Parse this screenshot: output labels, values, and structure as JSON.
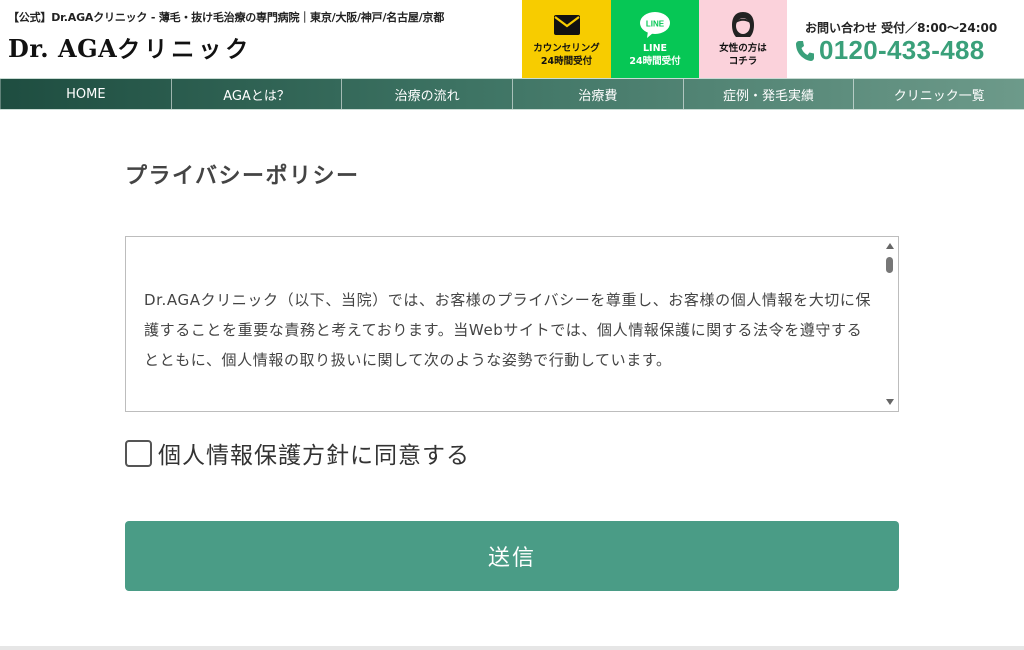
{
  "header": {
    "tagline": "【公式】Dr.AGAクリニック - 薄毛・抜け毛治療の専門病院｜東京/大阪/神戸/名古屋/京都",
    "logo_latin": "Dr. AGA",
    "logo_kana": "クリニック",
    "buttons": [
      {
        "line1": "カウンセリング",
        "line2": "24時間受付",
        "icon": "mail-icon",
        "color": "#f7cc00"
      },
      {
        "line1": "LINE",
        "line2": "24時間受付",
        "icon": "line-chat-icon",
        "color": "#06c755"
      },
      {
        "line1": "女性の方は",
        "line2": "コチラ",
        "icon": "woman-icon",
        "color": "#fbd2db"
      }
    ],
    "contact": {
      "hours": "お問い合わせ 受付／8:00〜24:00",
      "phone": "0120-433-488",
      "icon": "phone-icon",
      "phone_color": "#3aa07a"
    }
  },
  "nav": {
    "items": [
      {
        "label": "HOME"
      },
      {
        "label": "AGAとは？"
      },
      {
        "label": "治療の流れ"
      },
      {
        "label": "治療費"
      },
      {
        "label": "症例・発毛実績"
      },
      {
        "label": "クリニック一覧"
      }
    ]
  },
  "main": {
    "heading": "プライバシーポリシー",
    "policy_text": "Dr.AGAクリニック（以下、当院）では、お客様のプライバシーを尊重し、お客様の個人情報を大切に保護することを重要な責務と考えております。当Webサイトでは、個人情報保護に関する法令を遵守するとともに、個人情報の取り扱いに関して次のような姿勢で行動しています。",
    "agree_label": "個人情報保護方針に同意する",
    "agree_checked": false,
    "submit_label": "送信",
    "accent_color": "#4a9c86"
  }
}
